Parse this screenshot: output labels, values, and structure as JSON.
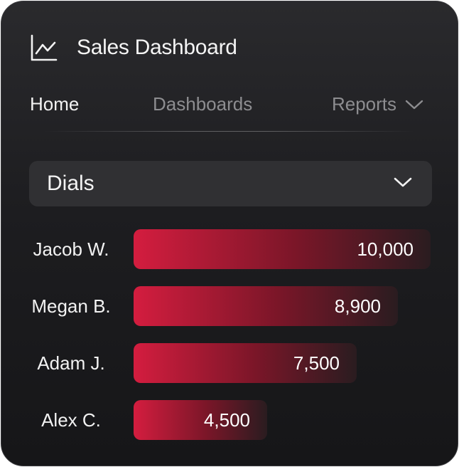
{
  "app": {
    "title": "Sales Dashboard",
    "icon": "line-chart-icon"
  },
  "nav": {
    "items": [
      {
        "label": "Home",
        "active": true
      },
      {
        "label": "Dashboards",
        "active": false
      },
      {
        "label": "Reports",
        "active": false,
        "icon": "chevron-down-icon"
      }
    ]
  },
  "metric_select": {
    "value": "Dials",
    "icon": "chevron-down-icon"
  },
  "leaderboard": {
    "max": 10000,
    "rows": [
      {
        "name": "Jacob W.",
        "value": 10000,
        "display": "10,000"
      },
      {
        "name": "Megan B.",
        "value": 8900,
        "display": "8,900"
      },
      {
        "name": "Adam J.",
        "value": 7500,
        "display": "7,500"
      },
      {
        "name": "Alex C.",
        "value": 4500,
        "display": "4,500"
      }
    ]
  },
  "colors": {
    "bar_start": "#d41d3f",
    "bar_end": "#2a1c20",
    "card_bg": "#1d1d20",
    "muted_text": "#8d8d90"
  }
}
